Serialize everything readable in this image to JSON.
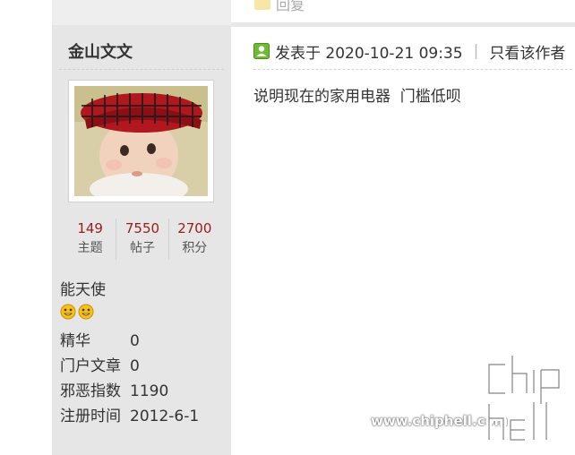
{
  "reply_remnant": {
    "label": "回复"
  },
  "user": {
    "name": "金山文文",
    "stats": [
      {
        "value": "149",
        "label": "主题"
      },
      {
        "value": "7550",
        "label": "帖子"
      },
      {
        "value": "2700",
        "label": "积分"
      }
    ],
    "group": "能天使",
    "info": [
      {
        "key": "精华",
        "value": "0"
      },
      {
        "key": "门户文章",
        "value": "0"
      },
      {
        "key": "邪恶指数",
        "value": "1190"
      },
      {
        "key": "注册时间",
        "value": "2012-6-1"
      }
    ]
  },
  "post": {
    "posted_at": "发表于 2020-10-21 09:35",
    "only_author_link": "只看该作者",
    "body": "说明现在的家用电器  门槛低呗"
  },
  "watermark": {
    "url": "www.chiphell.com",
    "logo_text": "chiphell"
  },
  "colors": {
    "stat_number": "#9b1b1b",
    "sidebar_bg": "#e6e6e6"
  }
}
